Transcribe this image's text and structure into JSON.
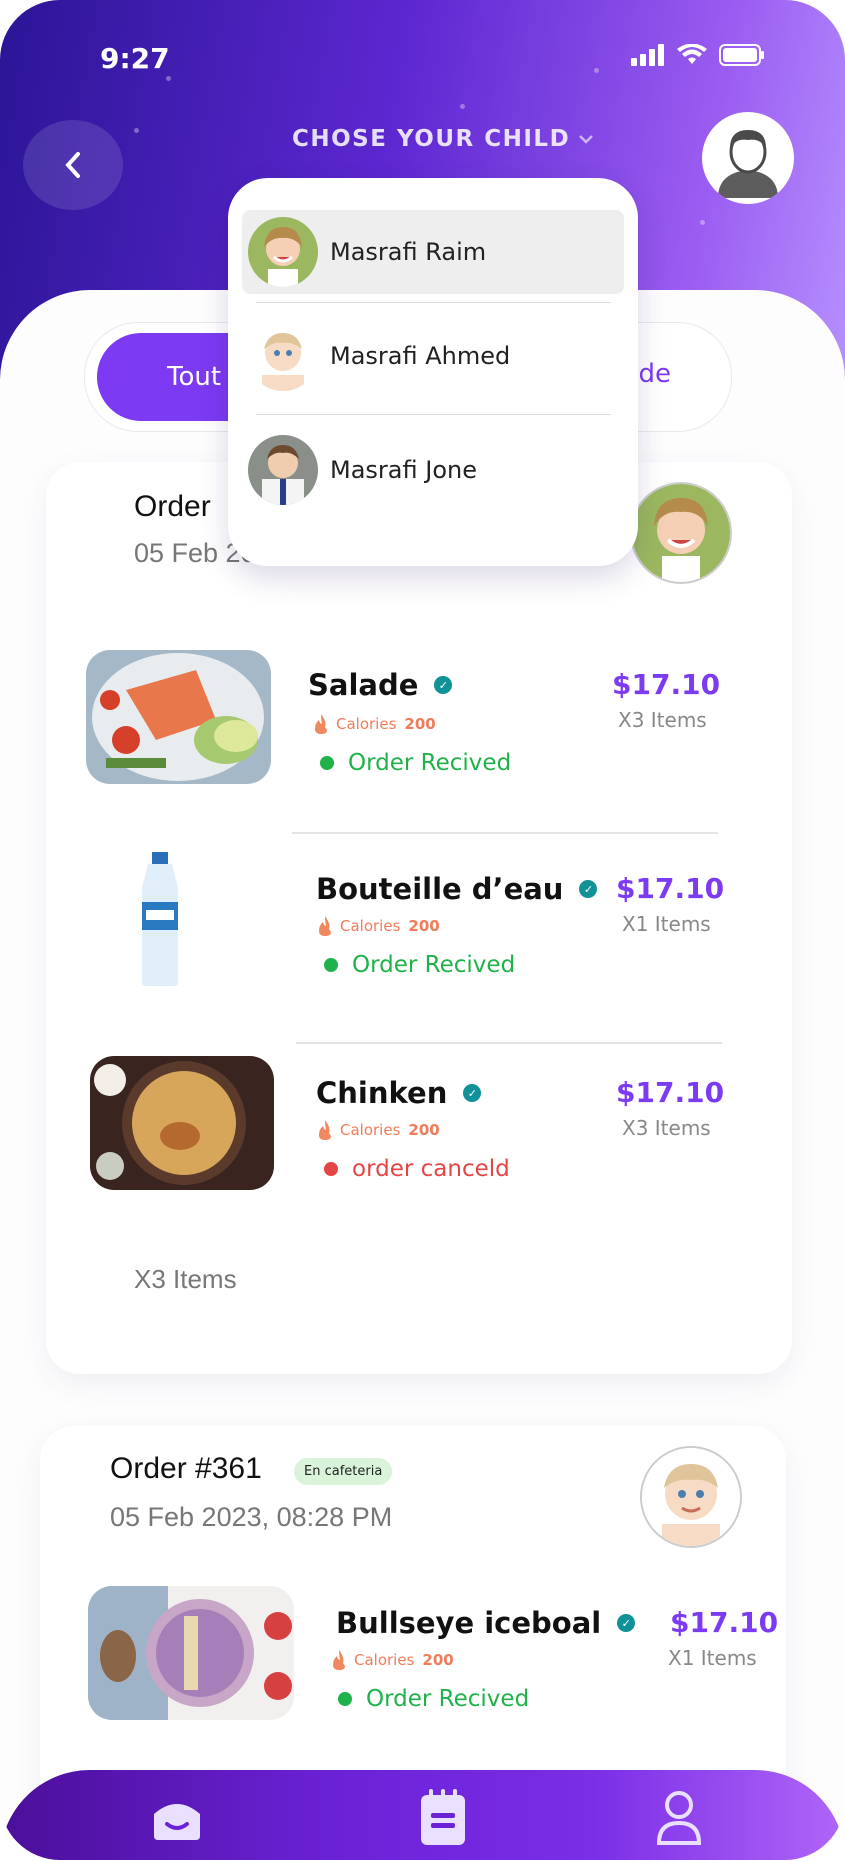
{
  "status_bar": {
    "time": "9:27"
  },
  "header": {
    "title": "CHOSE YOUR CHILD"
  },
  "tabs": {
    "active_label": "Tout",
    "right_label": "de"
  },
  "dropdown": {
    "items": [
      {
        "name": "Masrafi Raim",
        "selected": true
      },
      {
        "name": "Masrafi Ahmed",
        "selected": false
      },
      {
        "name": "Masrafi Jone",
        "selected": false
      }
    ]
  },
  "orders": [
    {
      "title": "Order",
      "date": "05 Feb 20",
      "footer_items": "X3 Items",
      "items": [
        {
          "name": "Salade",
          "calories_label": "Calories",
          "calories": "200",
          "status": "Order Recived",
          "status_color": "#20b24a",
          "price": "$17.10",
          "qty": "X3 Items"
        },
        {
          "name": "Bouteille d’eau",
          "calories_label": "Calories",
          "calories": "200",
          "status": "Order Recived",
          "status_color": "#20b24a",
          "price": "$17.10",
          "qty": "X1 Items"
        },
        {
          "name": "Chinken",
          "calories_label": "Calories",
          "calories": "200",
          "status": "order canceld",
          "status_color": "#e54545",
          "price": "$17.10",
          "qty": "X3 Items"
        }
      ]
    },
    {
      "title": "Order #361",
      "badge": "En cafeteria",
      "date": "05 Feb 2023, 08:28 PM",
      "items": [
        {
          "name": "Bullseye iceboal",
          "calories_label": "Calories",
          "calories": "200",
          "status": "Order Recived",
          "status_color": "#20b24a",
          "price": "$17.10",
          "qty": "X1 Items"
        }
      ]
    }
  ],
  "nav": {
    "items": [
      "home-icon",
      "orders-icon",
      "profile-icon"
    ]
  },
  "colors": {
    "accent": "#7c3af2",
    "success": "#20b24a",
    "danger": "#e54545",
    "calorie": "#f07c5a"
  }
}
